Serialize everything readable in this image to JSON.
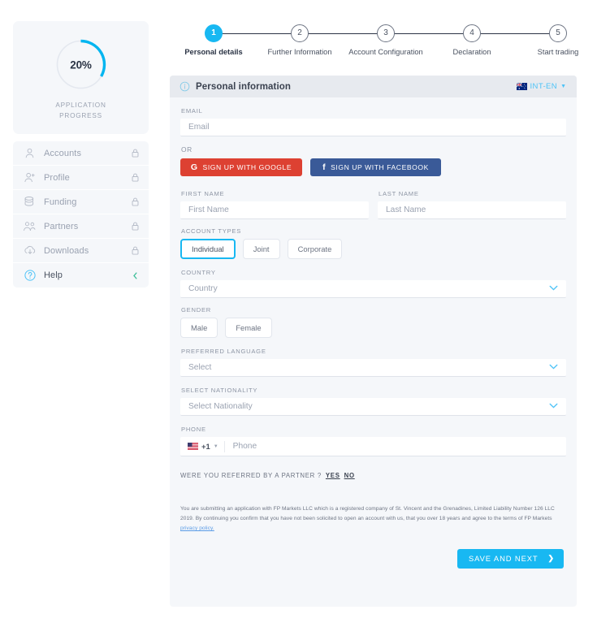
{
  "sidebar": {
    "progress": {
      "percent_label": "20%",
      "percent_value": 20,
      "caption_line1": "APPLICATION",
      "caption_line2": "PROGRESS",
      "ring_color": "#00b5f0",
      "track_color": "#e4e8ef"
    },
    "items": [
      {
        "label": "Accounts",
        "icon": "person-icon",
        "right_icon": "lock-icon",
        "active": false
      },
      {
        "label": "Profile",
        "icon": "person-add-icon",
        "right_icon": "lock-icon",
        "active": false
      },
      {
        "label": "Funding",
        "icon": "coins-stack-icon",
        "right_icon": "lock-icon",
        "active": false
      },
      {
        "label": "Partners",
        "icon": "people-icon",
        "right_icon": "lock-icon",
        "active": false
      },
      {
        "label": "Downloads",
        "icon": "cloud-download-icon",
        "right_icon": "lock-icon",
        "active": false
      },
      {
        "label": "Help",
        "icon": "help-circle-icon",
        "right_icon": "chevron-left-icon",
        "active": true
      }
    ]
  },
  "stepper": {
    "steps": [
      {
        "number": "1",
        "label": "Personal details",
        "current": true
      },
      {
        "number": "2",
        "label": "Further Information",
        "current": false
      },
      {
        "number": "3",
        "label": "Account Configuration",
        "current": false
      },
      {
        "number": "4",
        "label": "Declaration",
        "current": false
      },
      {
        "number": "5",
        "label": "Start trading",
        "current": false
      }
    ]
  },
  "panel": {
    "title": "Personal information",
    "language": {
      "code": "INT-EN",
      "flag": "australia-flag"
    },
    "email": {
      "label": "EMAIL",
      "placeholder": "Email",
      "value": ""
    },
    "or_text": "OR",
    "social": {
      "google": {
        "label": "SIGN UP WITH GOOGLE",
        "glyph": "G",
        "color": "#dd4132"
      },
      "facebook": {
        "label": "SIGN UP WITH FACEBOOK",
        "glyph": "f",
        "color": "#3a5a98"
      }
    },
    "first_name": {
      "label": "FIRST NAME",
      "placeholder": "First Name",
      "value": ""
    },
    "last_name": {
      "label": "LAST NAME",
      "placeholder": "Last Name",
      "value": ""
    },
    "account_types": {
      "label": "ACCOUNT TYPES",
      "options": [
        {
          "label": "Individual",
          "selected": true
        },
        {
          "label": "Joint",
          "selected": false
        },
        {
          "label": "Corporate",
          "selected": false
        }
      ]
    },
    "country": {
      "label": "COUNTRY",
      "placeholder": "Country",
      "value": ""
    },
    "gender": {
      "label": "GENDER",
      "options": [
        {
          "label": "Male",
          "selected": false
        },
        {
          "label": "Female",
          "selected": false
        }
      ]
    },
    "preferred_language": {
      "label": "PREFERRED LANGUAGE",
      "placeholder": "Select",
      "value": ""
    },
    "nationality": {
      "label": "SELECT NATIONALITY",
      "placeholder": "Select Nationality",
      "value": ""
    },
    "phone": {
      "label": "PHONE",
      "country_code": "+1",
      "flag": "usa-flag",
      "placeholder": "Phone",
      "value": ""
    },
    "referral": {
      "question": "WERE YOU REFERRED BY A PARTNER ?",
      "yes_label": "YES",
      "no_label": "NO"
    },
    "disclaimer": {
      "text": "You are submitting an application with FP Markets LLC which is a registered company of St. Vincent and the Grenadines, Limited Liability Number 126 LLC 2019. By continuing you confirm that you have not been solicited to open an account with us, that you over 18 years and agree to the terms of FP Markets ",
      "link_text": "privacy policy."
    },
    "save_button": {
      "label": "SAVE AND NEXT",
      "color": "#18b8f2"
    }
  }
}
